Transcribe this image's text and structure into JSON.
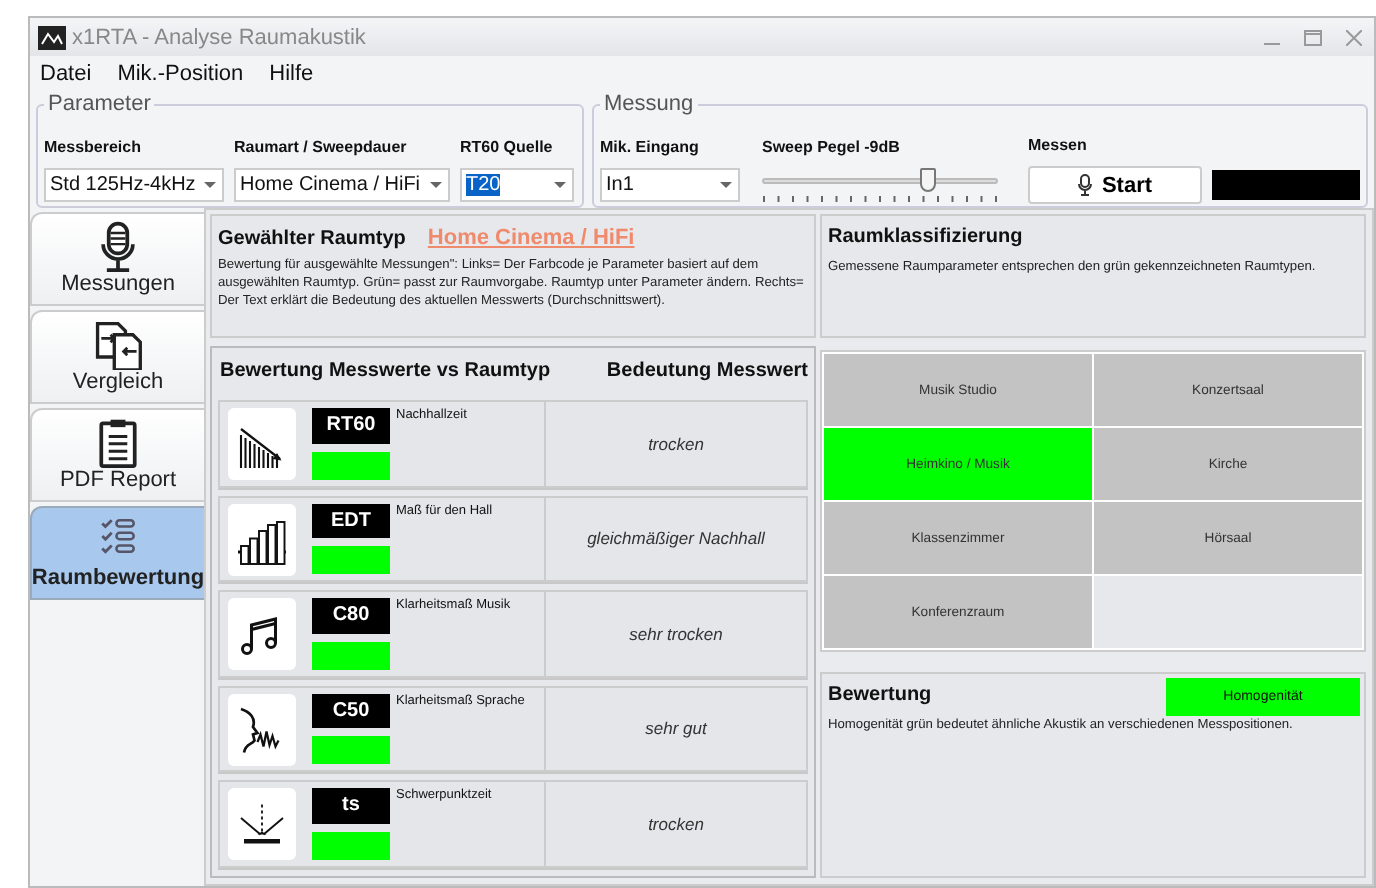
{
  "window": {
    "title": "x1RTA - Analyse Raumakustik"
  },
  "menu": [
    "Datei",
    "Mik.-Position",
    "Hilfe"
  ],
  "parameter": {
    "legend": "Parameter",
    "fields": [
      {
        "label": "Messbereich",
        "value": "Std 125Hz-4kHz",
        "selected": false
      },
      {
        "label": "Raumart / Sweepdauer",
        "value": "Home Cinema / HiFi",
        "selected": false
      },
      {
        "label": "RT60 Quelle",
        "value": "T20",
        "selected": true
      }
    ]
  },
  "messung": {
    "legend": "Messung",
    "input": {
      "label": "Mik. Eingang",
      "value": "In1"
    },
    "slider": {
      "label": "Sweep Pegel -9dB",
      "level": 0.7
    },
    "measure": {
      "label": "Messen",
      "button": "Start"
    }
  },
  "tabs": [
    {
      "label": "Messungen",
      "kind": "mic",
      "selected": false
    },
    {
      "label": "Vergleich",
      "kind": "compare",
      "selected": false
    },
    {
      "label": "PDF Report",
      "kind": "clipboard",
      "selected": false
    },
    {
      "label": "Raumbewertung",
      "kind": "checklist",
      "selected": true
    }
  ],
  "roomtype": {
    "title": "Gewählter Raumtyp",
    "link": "Home Cinema / HiFi",
    "description": "Bewertung für ausgewählte Messungen\": Links= Der Farbcode je Parameter basiert auf dem ausgewählten Raumtyp.  Grün= passt zur Raumvorgabe.  Raumtyp unter Parameter ändern. Rechts= Der Text erklärt die Bedeutung des aktuellen Messwerts (Durchschnittswert)."
  },
  "ratings": {
    "title": "Bewertung Messwerte vs Raumtyp",
    "meaning_title": "Bedeutung Messwert",
    "rows": [
      {
        "kind": "decay",
        "code": "RT60",
        "caption": "Nachhallzeit",
        "meaning": "trocken",
        "color": "#00ff00"
      },
      {
        "kind": "bars",
        "code": "EDT",
        "caption": "Maß für den Hall",
        "meaning": "gleichmäßiger Nachhall",
        "color": "#00ff00"
      },
      {
        "kind": "note",
        "code": "C80",
        "caption": "Klarheitsmaß Musik",
        "meaning": "sehr trocken",
        "color": "#00ff00"
      },
      {
        "kind": "speech",
        "code": "C50",
        "caption": "Klarheitsmaß Sprache",
        "meaning": "sehr gut",
        "color": "#00ff00"
      },
      {
        "kind": "reflection",
        "code": "ts",
        "caption": "Schwerpunktzeit",
        "meaning": "trocken",
        "color": "#00ff00"
      }
    ]
  },
  "classification": {
    "title": "Raumklassifizierung",
    "description": "Gemessene Raumparameter entsprechen den grün gekennzeichneten Raumtypen.",
    "rooms": [
      {
        "label": "Musik Studio",
        "selected": false
      },
      {
        "label": "Konzertsaal",
        "selected": false
      },
      {
        "label": "Heimkino / Musik",
        "selected": true
      },
      {
        "label": "Kirche",
        "selected": false
      },
      {
        "label": "Klassenzimmer",
        "selected": false
      },
      {
        "label": "Hörsaal",
        "selected": false
      },
      {
        "label": "Konferenzraum",
        "selected": false
      }
    ]
  },
  "evaluation": {
    "title": "Bewertung",
    "badge": "Homogenität",
    "color": "#00ff00",
    "description": "Homogenität grün bedeutet ähnliche Akustik an verschiedenen Messpositionen."
  }
}
